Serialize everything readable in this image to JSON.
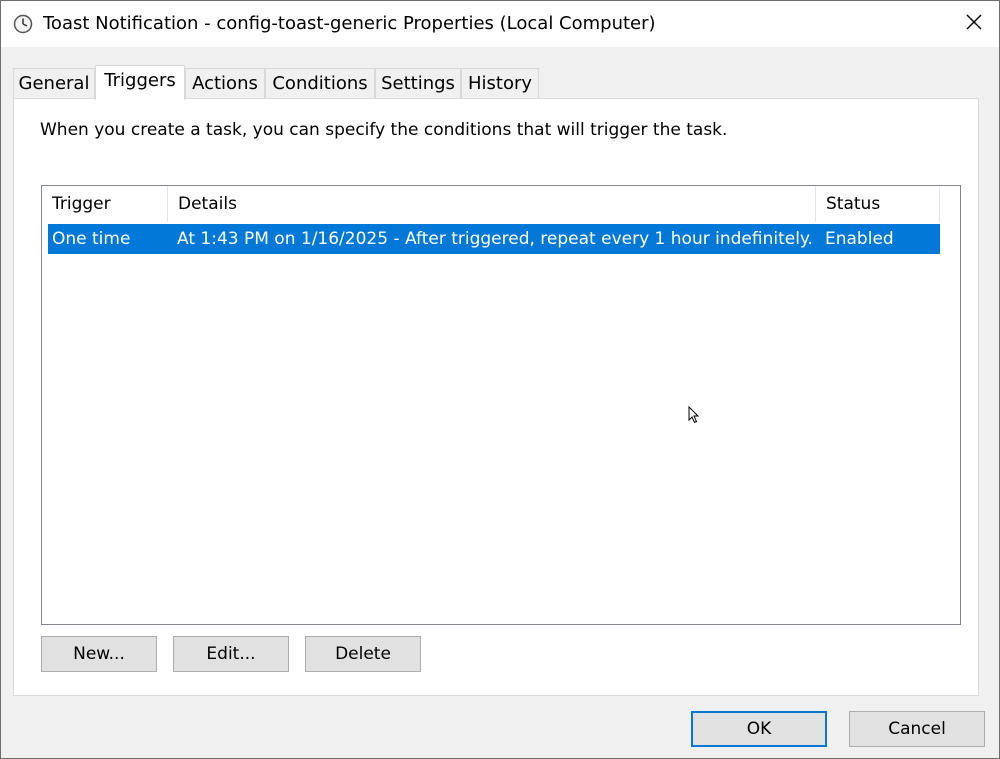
{
  "window": {
    "title": "Toast Notification - config-toast-generic Properties (Local Computer)",
    "icon": "clock-icon",
    "close_icon": "close-icon"
  },
  "tabs": [
    {
      "label": "General",
      "active": false
    },
    {
      "label": "Triggers",
      "active": true
    },
    {
      "label": "Actions",
      "active": false
    },
    {
      "label": "Conditions",
      "active": false
    },
    {
      "label": "Settings",
      "active": false
    },
    {
      "label": "History",
      "active": false
    }
  ],
  "triggers_panel": {
    "description": "When you create a task, you can specify the conditions that will trigger the task.",
    "columns": [
      "Trigger",
      "Details",
      "Status"
    ],
    "rows": [
      {
        "trigger": "One time",
        "details": "At 1:43 PM on 1/16/2025 - After triggered, repeat every 1 hour indefinitely.",
        "status": "Enabled",
        "selected": true
      }
    ],
    "buttons": {
      "new_label": "New...",
      "edit_label": "Edit...",
      "delete_label": "Delete"
    }
  },
  "footer": {
    "ok_label": "OK",
    "cancel_label": "Cancel"
  },
  "colors": {
    "selection": "#0078d7",
    "window_bg": "#f0f0f0"
  }
}
